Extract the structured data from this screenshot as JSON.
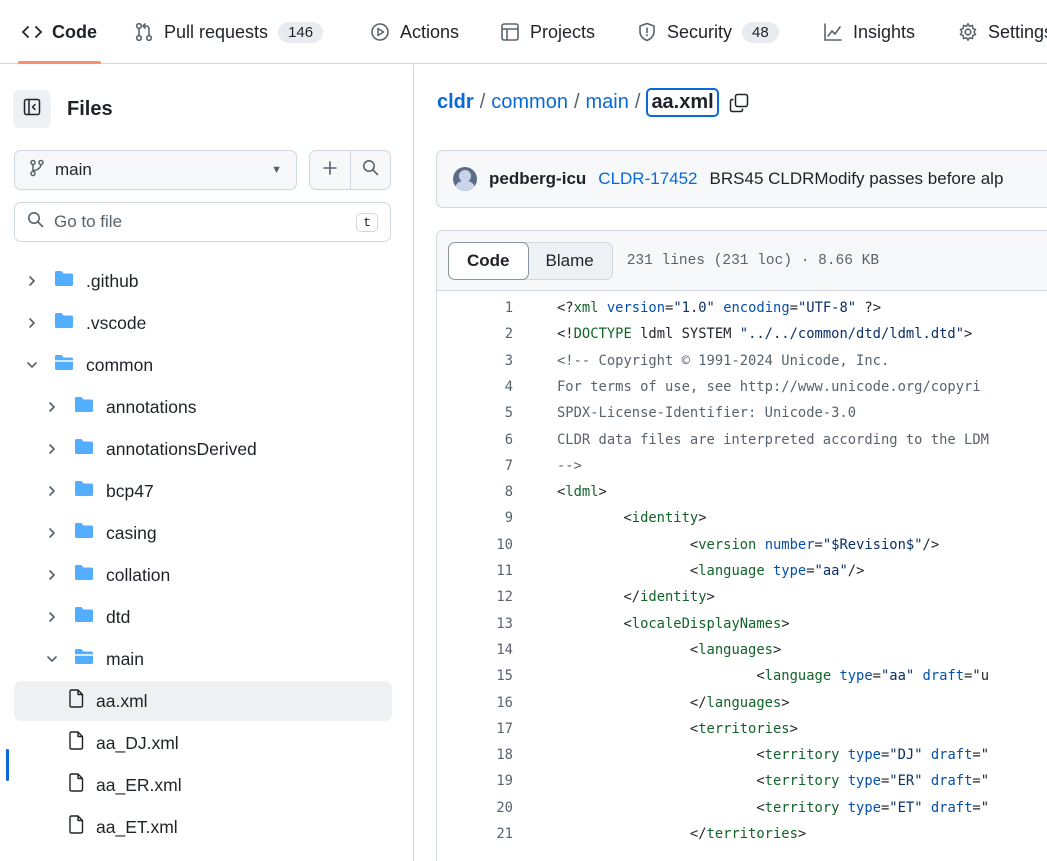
{
  "nav": {
    "tabs": [
      {
        "label": "Code",
        "icon": "code-icon",
        "active": true
      },
      {
        "label": "Pull requests",
        "icon": "git-pull-request-icon",
        "count": "146"
      },
      {
        "label": "Actions",
        "icon": "play-icon"
      },
      {
        "label": "Projects",
        "icon": "table-icon"
      },
      {
        "label": "Security",
        "icon": "shield-icon",
        "count": "48"
      },
      {
        "label": "Insights",
        "icon": "graph-icon"
      },
      {
        "label": "Settings",
        "icon": "gear-icon"
      }
    ]
  },
  "sidebar": {
    "title": "Files",
    "branch": "main",
    "search_placeholder": "Go to file",
    "search_shortcut": "t",
    "tree": [
      {
        "label": ".github",
        "type": "folder",
        "expanded": false
      },
      {
        "label": ".vscode",
        "type": "folder",
        "expanded": false
      },
      {
        "label": "common",
        "type": "folder",
        "expanded": true
      },
      {
        "label": "annotations",
        "type": "folder",
        "expanded": false
      },
      {
        "label": "annotationsDerived",
        "type": "folder",
        "expanded": false
      },
      {
        "label": "bcp47",
        "type": "folder",
        "expanded": false
      },
      {
        "label": "casing",
        "type": "folder",
        "expanded": false
      },
      {
        "label": "collation",
        "type": "folder",
        "expanded": false
      },
      {
        "label": "dtd",
        "type": "folder",
        "expanded": false
      },
      {
        "label": "main",
        "type": "folder",
        "expanded": true
      },
      {
        "label": "aa.xml",
        "type": "file",
        "selected": true
      },
      {
        "label": "aa_DJ.xml",
        "type": "file"
      },
      {
        "label": "aa_ER.xml",
        "type": "file"
      },
      {
        "label": "aa_ET.xml",
        "type": "file"
      }
    ]
  },
  "breadcrumb": {
    "repo": "cldr",
    "parts": [
      "common",
      "main"
    ],
    "current": "aa.xml"
  },
  "commit": {
    "author": "pedberg-icu",
    "issue": "CLDR-17452",
    "message": "BRS45 CLDRModify passes before alp"
  },
  "file": {
    "view_tabs": [
      "Code",
      "Blame"
    ],
    "active_view": "Code",
    "meta": "231 lines (231 loc) · 8.66 KB"
  },
  "code_lines": [
    "<?xml version=\"1.0\" encoding=\"UTF-8\" ?>",
    "<!DOCTYPE ldml SYSTEM \"../../common/dtd/ldml.dtd\">",
    "<!-- Copyright © 1991-2024 Unicode, Inc.",
    "For terms of use, see http://www.unicode.org/copyri",
    "SPDX-License-Identifier: Unicode-3.0",
    "CLDR data files are interpreted according to the LDM",
    "-->",
    "<ldml>",
    "        <identity>",
    "                <version number=\"$Revision$\"/>",
    "                <language type=\"aa\"/>",
    "        </identity>",
    "        <localeDisplayNames>",
    "                <languages>",
    "                        <language type=\"aa\" draft=\"u",
    "                </languages>",
    "                <territories>",
    "                        <territory type=\"DJ\" draft=\"",
    "                        <territory type=\"ER\" draft=\"",
    "                        <territory type=\"ET\" draft=\"",
    "                </territories>"
  ],
  "colors": {
    "accent": "#0969da",
    "tab_underline": "#fd8c73",
    "folder": "#54aeff"
  }
}
